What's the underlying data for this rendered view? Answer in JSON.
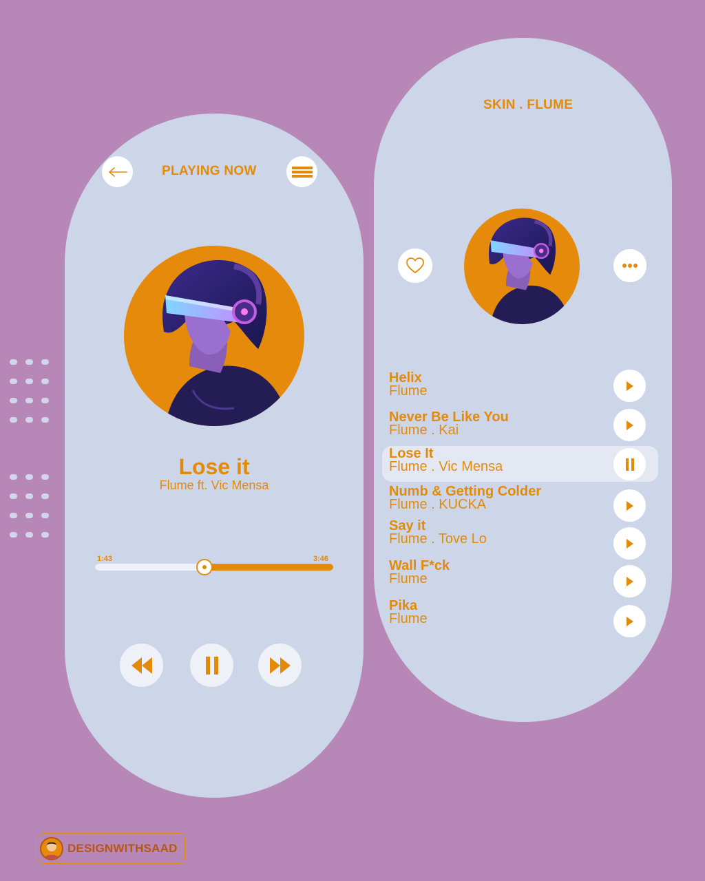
{
  "now_playing": {
    "header": "PLAYING NOW",
    "song_title": "Lose it",
    "artist": "Flume ft. Vic Mensa",
    "elapsed": "1:43",
    "duration": "3:46",
    "progress": 0.46
  },
  "playlist": {
    "header": "SKIN . FLUME",
    "tracks": [
      {
        "name": "Helix",
        "artist": "Flume",
        "state": "play"
      },
      {
        "name": "Never Be Like You",
        "artist": "Flume . Kai",
        "state": "play"
      },
      {
        "name": "Lose It",
        "artist": "Flume . Vic Mensa",
        "state": "pause"
      },
      {
        "name": "Numb & Getting Colder",
        "artist": "Flume . KUCKA",
        "state": "play"
      },
      {
        "name": "Say it",
        "artist": "Flume . Tove Lo",
        "state": "play"
      },
      {
        "name": "Wall F*ck",
        "artist": "Flume",
        "state": "play"
      },
      {
        "name": "Pika",
        "artist": "Flume",
        "state": "play"
      }
    ]
  },
  "brand": {
    "label": "DESIGNWITHSAAD"
  },
  "colors": {
    "background": "#b788b7",
    "card": "#cdd6e9",
    "accent": "#e28b0b"
  },
  "icons": [
    "back-arrow-icon",
    "menu-icon",
    "rewind-icon",
    "pause-icon",
    "fast-forward-icon",
    "heart-icon",
    "more-icon",
    "play-icon"
  ]
}
